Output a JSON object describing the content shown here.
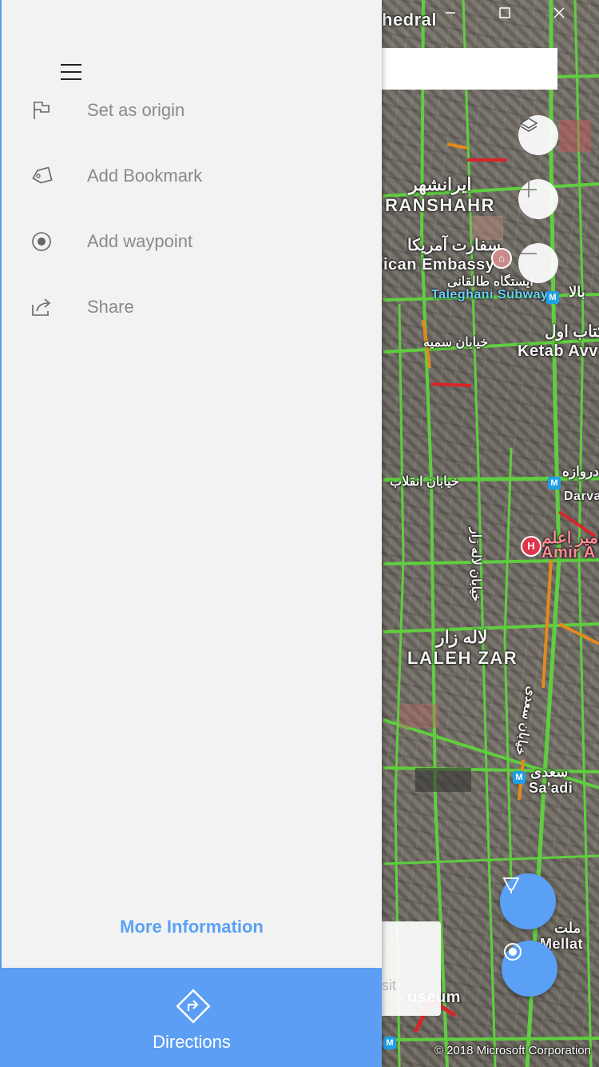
{
  "window": {
    "minimize_icon": "minimize-icon",
    "maximize_icon": "maximize-icon",
    "close_icon": "close-icon"
  },
  "panel": {
    "menu_icon": "hamburger-icon",
    "items": [
      {
        "label": "Set as origin",
        "icon": "flag-icon"
      },
      {
        "label": "Add Bookmark",
        "icon": "tag-icon"
      },
      {
        "label": "Add waypoint",
        "icon": "waypoint-icon"
      },
      {
        "label": "Share",
        "icon": "share-icon"
      }
    ],
    "more_info": "More Information",
    "directions": {
      "label": "Directions",
      "icon": "directions-icon"
    }
  },
  "map": {
    "labels": {
      "cathedral": "hedral",
      "iranshahr_fa": "ایرانشهر",
      "iranshahr": "RANSHAHR",
      "embassy_fa": "سفارت آمریکا",
      "embassy": "ican Embassy",
      "taleghani_fa": "ایستگاه طالقانی",
      "taleghani": "Taleghani Subway",
      "ketab_fa": "کتاب اول",
      "ketab": "Ketab Avv",
      "somayeh_fa": "خیابان سمیه",
      "enghelab_fa": "خیابان انقلاب",
      "darvazeh_fa": "دروازه",
      "darvazeh": "Darva",
      "lalehzar_st_fa": "خیابان لاله زار",
      "amir_fa": "امیر اعلم",
      "amir": "Amir A",
      "lalehzar_fa": "لاله زار",
      "lalehzar": "LALEH ZAR",
      "saadi_st_fa": "خیابان سعدی",
      "saadi_fa": "سعدی",
      "saadi": "Sa'adi",
      "mellat_fa": "ملت",
      "mellat": "Mellat",
      "museum": "useum",
      "card_fragment": "sit"
    },
    "controls": {
      "layers_icon": "layers-icon",
      "zoom_in_icon": "zoom-in-icon",
      "zoom_out_icon": "zoom-out-icon",
      "ink_icon": "pen-icon",
      "locate_icon": "locate-icon"
    },
    "copyright": "© 2018 Microsoft Corporation",
    "colors": {
      "accent": "#5b9ef3",
      "road": "#5fce3f",
      "traffic_orange": "#e38a1c",
      "traffic_red": "#d8252b"
    }
  }
}
